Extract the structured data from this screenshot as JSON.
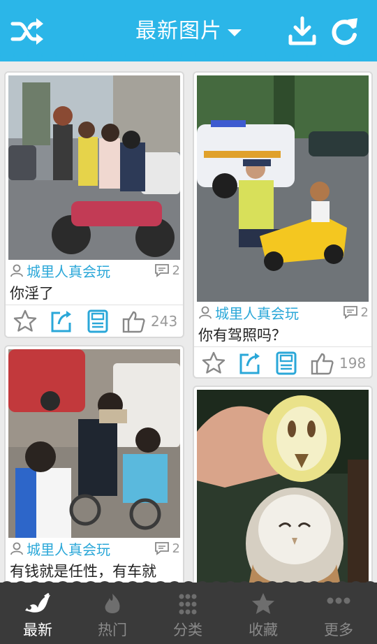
{
  "header": {
    "title": "最新图片",
    "icons": [
      "shuffle-icon",
      "download-icon",
      "refresh-icon"
    ],
    "color": "#2bb6e8"
  },
  "cards": [
    {
      "author": "城里人真会玩",
      "comments": "2",
      "caption": "你淫了",
      "likes": "243"
    },
    {
      "author": "城里人真会玩",
      "comments": "2",
      "caption": "你有驾照吗？",
      "likes": "198"
    },
    {
      "author": "城里人真会玩",
      "comments": "2",
      "caption": "有钱就是任性，有车就"
    }
  ],
  "tabs": [
    {
      "label": "最新",
      "icon": "bird-icon",
      "active": true
    },
    {
      "label": "热门",
      "icon": "flame-icon"
    },
    {
      "label": "分类",
      "icon": "grid-dots-icon"
    },
    {
      "label": "收藏",
      "icon": "star-icon"
    },
    {
      "label": "更多",
      "icon": "more-dots-icon"
    }
  ],
  "colors": {
    "accent": "#2bb6e8",
    "author": "#2aa7d8",
    "tabbar": "#3a3a3a"
  }
}
